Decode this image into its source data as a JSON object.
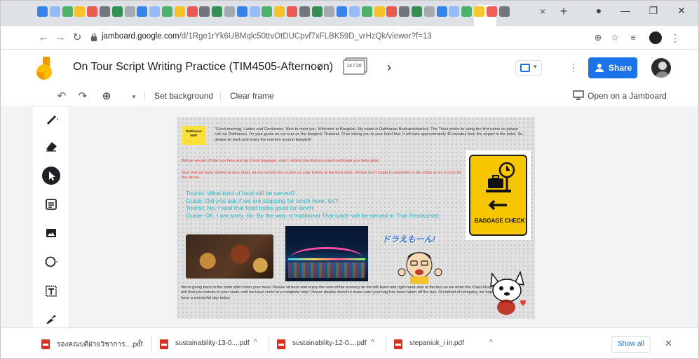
{
  "browser": {
    "tab_close_glyph": "×",
    "new_tab_glyph": "+",
    "window_controls": [
      "—",
      "❐",
      "✕"
    ],
    "url_host": "jamboard.google.com",
    "url_path": "/d/1Rge1rYk6UBMqlc50ttvOtDUCpvf7xFLBK59D_vrHzQk/viewer?f=13"
  },
  "jamboard": {
    "title": "On Tour Script Writing Practice (TIM4505-Afternoon)",
    "frame_counter": "14 / 20",
    "share_label": "Share"
  },
  "toolbar": {
    "set_background": "Set background",
    "clear_frame": "Clear frame",
    "open_on_jamboard": "Open on a Jamboard"
  },
  "board": {
    "sticky_note": "Ratthanan 9097",
    "intro": "\"Good morning, Ladies and Gentlemen. Nice to meet you. Welcome to Bangkok. My name is Ratthanan Budsarakhamkul. The Thais prefer to using the first name so please call me Ratthanan. I'm your guide on our tour on the bangkok Thailand. I'll be taking you to your hotel first. It will take approximately 40 minutes from the airport to the hotel. So, please sit back and enjoy the scenery around bangkok\"",
    "red_line_1": "Before we get off the bus here and go check baggage, may I remind you that you must not forget you belonging.",
    "red_line_2": "Now that we have arrived at your hotel, let me remind you to pick up your tickets at the front desk. Please don't forget to assemble in the lobby at six o'clock for the dinner.",
    "dialogue": [
      "Tourist: What kind of food will be served?",
      "Guide: Did you ask if we are stopping for lunch here, Sir?",
      "Tourist: No, I said that food looks good for lunch.",
      "Guide: Oh, I am sorry, Sir. By the way, a traditional Thai lunch will be served in Thai Restaurant."
    ],
    "closing": "We're going back to the hotel after finish your meal. Please sit back and enjoy the view of the scenery on the left-hand and right-hand side of the bus as we enter the Chao Phaya bridge. I ask that you remain in your seats until we have come to a complete stop. Please double check to make sure your bag has been taken off the bus. On behalf of company, we hope you have a wonderful day today.",
    "sign_text": "BAGGAGE CHECK",
    "cartoon_text": "ドラえもーん!"
  },
  "downloads": {
    "items": [
      {
        "name": "รองคณบดีฝ่ายวิชาการ....pdf"
      },
      {
        "name": "sustainability-13-0....pdf"
      },
      {
        "name": "sustainability-12-0....pdf"
      },
      {
        "name": "stepaniuk_i in.pdf"
      }
    ],
    "caret_glyph": "^",
    "show_all": "Show all",
    "close_glyph": "✕"
  },
  "colors": {
    "accent": "#1a73e8",
    "sticky": "#fbe03a",
    "red_text": "#e53935",
    "teal_text": "#29b6c6",
    "sign_yellow": "#f7c600"
  },
  "icons": [
    "back-arrow-icon",
    "forward-arrow-icon",
    "reload-icon",
    "lock-icon",
    "zoom-icon",
    "star-icon",
    "reading-list-icon",
    "profile-icon",
    "more-icon",
    "undo-icon",
    "redo-icon",
    "zoom-in-icon",
    "pen-icon",
    "eraser-icon",
    "select-icon",
    "sticky-note-icon",
    "image-icon",
    "circle-icon",
    "text-box-icon",
    "laser-icon",
    "present-icon",
    "share-people-icon",
    "pdf-icon"
  ]
}
